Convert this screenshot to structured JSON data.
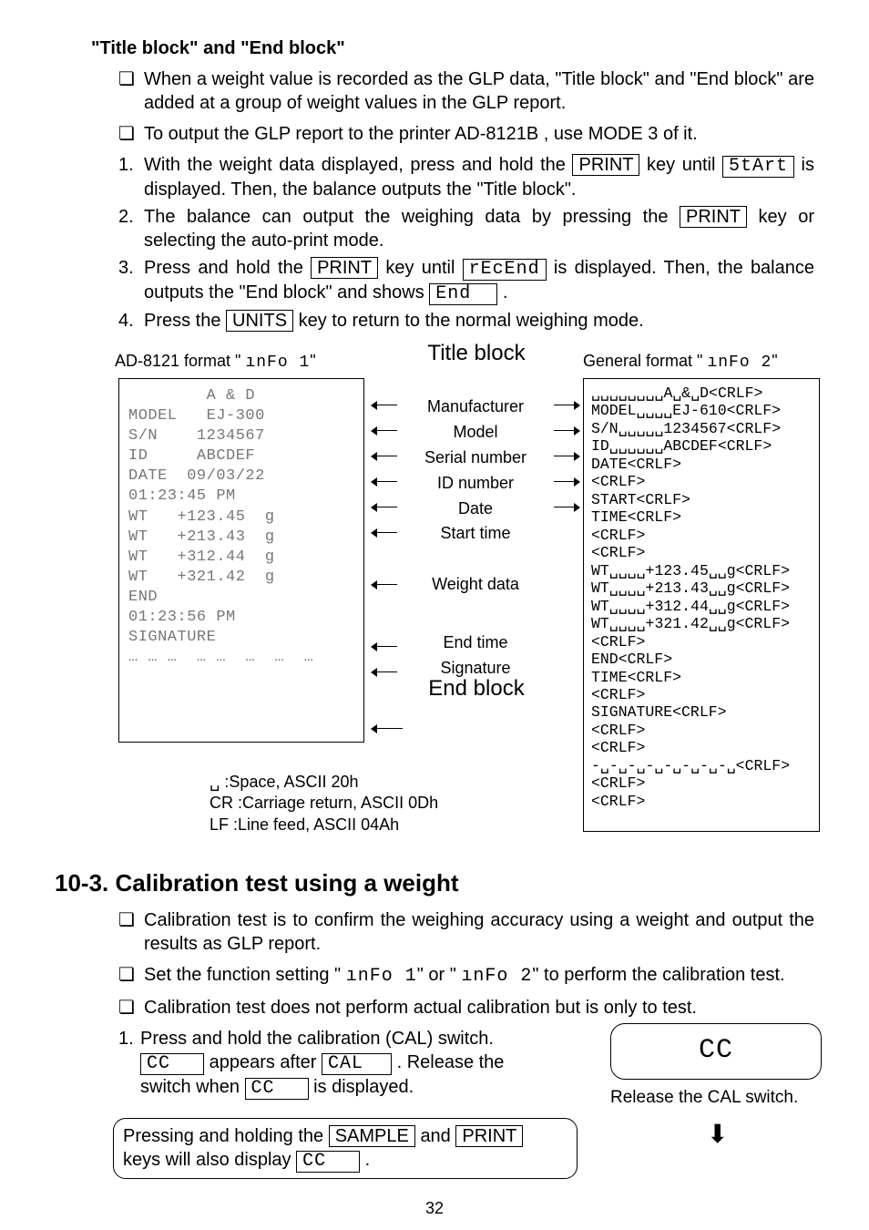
{
  "section1": {
    "title": "\"Title block\" and \"End block\"",
    "bullets": [
      "When a weight value is recorded as the GLP data, \"Title block\" and \"End block\" are added at a group of weight values in the GLP report.",
      "To output the GLP report to the printer AD-8121B , use MODE 3 of it."
    ],
    "step1_a": "With the weight data displayed, press and hold the ",
    "step1_key": "PRINT",
    "step1_b": " key until ",
    "step1_seg": "5tArt",
    "step1_c": " is displayed. Then, the balance outputs the \"Title block\".",
    "step2_a": "The balance can output the weighing data by pressing the ",
    "step2_key": "PRINT",
    "step2_b": " key or selecting the auto-print mode.",
    "step3_a": "Press and hold the ",
    "step3_key": "PRINT",
    "step3_b": " key until ",
    "step3_seg1": "rEcEnd",
    "step3_c": " is displayed. Then, the balance outputs the \"End block\" and shows ",
    "step3_seg2": "End",
    "step3_d": ".",
    "step4_a": "Press the ",
    "step4_key": "UNITS",
    "step4_b": " key to return to the normal weighing mode."
  },
  "diagram": {
    "ad8121_label_a": "AD-8121 format \" ",
    "ad8121_label_seg": "ınFo  1",
    "ad8121_label_b": "\"",
    "general_label_a": "General format \" ",
    "general_label_seg": "ınFo  2",
    "general_label_b": "\"",
    "title_block": "Title block",
    "end_block": "End block",
    "mid_items": [
      "Manufacturer",
      "Model",
      "Serial number",
      "ID number",
      "Date",
      "Start time",
      "Weight data",
      "End time",
      "Signature"
    ],
    "left_lines": [
      "        A & D",
      "MODEL   EJ-300",
      "S/N    1234567",
      "ID     ABCDEF",
      "DATE  09/03/22",
      "01:23:45 PM",
      "",
      "WT   +123.45  g",
      "WT   +213.43  g",
      "WT   +312.44  g",
      "WT   +321.42  g",
      "",
      "END",
      "01:23:56 PM",
      "SIGNATURE",
      "",
      "",
      "… … …  … …  …  …  …"
    ],
    "right_lines": [
      "␣␣␣␣␣␣␣␣A␣&␣D<CRLF>",
      "MODEL␣␣␣␣EJ-610<CRLF>",
      "S/N␣␣␣␣␣1234567<CRLF>",
      "ID␣␣␣␣␣␣ABCDEF<CRLF>",
      "DATE<CRLF>",
      "<CRLF>",
      "START<CRLF>",
      "TIME<CRLF>",
      "<CRLF>",
      "<CRLF>",
      "WT␣␣␣␣+123.45␣␣g<CRLF>",
      "WT␣␣␣␣+213.43␣␣g<CRLF>",
      "WT␣␣␣␣+312.44␣␣g<CRLF>",
      "WT␣␣␣␣+321.42␣␣g<CRLF>",
      "<CRLF>",
      "END<CRLF>",
      "TIME<CRLF>",
      "<CRLF>",
      "SIGNATURE<CRLF>",
      "<CRLF>",
      "<CRLF>",
      "-␣-␣-␣-␣-␣-␣-␣-␣<CRLF>",
      "<CRLF>",
      "<CRLF>"
    ],
    "footnote_space": "␣  :Space, ASCII 20h",
    "footnote_cr": "CR :Carriage return, ASCII 0Dh",
    "footnote_lf": "LF :Line feed, ASCII 04Ah"
  },
  "section2": {
    "heading": "10-3. Calibration test using a weight",
    "bullets_a": "Calibration test is to confirm the weighing accuracy using a weight and output the results as GLP report.",
    "bullets_b_pre": "Set the function setting \" ",
    "bullets_b_seg1": "ınFo  1",
    "bullets_b_mid": "\" or \" ",
    "bullets_b_seg2": "ınFo  2",
    "bullets_b_post": "\" to perform the calibration test.",
    "bullets_c": "Calibration test does not perform actual calibration but is only to test.",
    "step1_a": "Press and hold the calibration (CAL) switch.",
    "step1_line2_seg1": "CC",
    "step1_line2_mid": " appears after ",
    "step1_line2_seg2": "CAL",
    "step1_line2_tail": ". Release the ",
    "step1_line3_pre": "switch when ",
    "step1_line3_seg": "CC",
    "step1_line3_tail": " is displayed.",
    "group_a": "Pressing and holding the ",
    "group_key1": "SAMPLE",
    "group_mid": " and ",
    "group_key2": "PRINT",
    "group_line2_pre": "keys will also display ",
    "group_line2_seg": "CC",
    "group_line2_tail": ".",
    "panel_value": "CC",
    "panel_caption": "Release the CAL switch.",
    "downarrow": "⬇"
  },
  "page_number": "32"
}
